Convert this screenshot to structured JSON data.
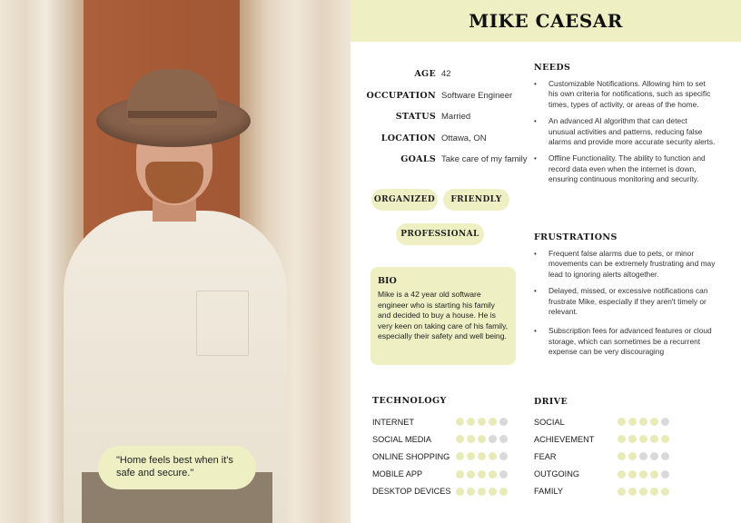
{
  "persona": {
    "name": "MIKE CAESAR",
    "quote": "\"Home feels best when it's safe and secure.\""
  },
  "facts": [
    {
      "key": "AGE",
      "value": "42"
    },
    {
      "key": "OCCUPATION",
      "value": "Software Engineer"
    },
    {
      "key": "STATUS",
      "value": "Married"
    },
    {
      "key": "LOCATION",
      "value": "Ottawa, ON"
    },
    {
      "key": "GOALS",
      "value": "Take care of my family"
    }
  ],
  "traits": [
    "ORGANIZED",
    "FRIENDLY",
    "PROFESSIONAL"
  ],
  "bio": {
    "title": "BIO",
    "text": "Mike is a 42 year old software engineer who is starting his family and decided to buy a house. He is very keen on taking care of his family, especially their safety and well being."
  },
  "needs": {
    "title": "NEEDS",
    "items": [
      "Customizable Notifications. Allowing him to set his own criteria for notifications, such as specific times, types of activity, or areas of the home.",
      "An advanced AI algorithm that can detect unusual activities and patterns, reducing false alarms and provide more accurate security alerts.",
      "Offline Functionality. The ability to function and record data even when the internet is down, ensuring continuous monitoring and security."
    ]
  },
  "frustrations": {
    "title": "FRUSTRATIONS",
    "items": [
      "Frequent false alarms due to pets, or minor movements can be extremely frustrating and may lead to ignoring alerts altogether.",
      "Delayed, missed, or excessive notifications can frustrate Mike, especially if they aren't timely or relevant.",
      "Subscription fees for advanced features or cloud storage, which can sometimes be a recurrent expense can be very discouraging"
    ]
  },
  "technology": {
    "title": "TECHNOLOGY",
    "max": 5,
    "items": [
      {
        "label": "INTERNET",
        "rating": 4
      },
      {
        "label": "SOCIAL MEDIA",
        "rating": 3
      },
      {
        "label": "ONLINE SHOPPING",
        "rating": 4
      },
      {
        "label": "MOBILE APP",
        "rating": 4
      },
      {
        "label": "DESKTOP DEVICES",
        "rating": 5
      }
    ]
  },
  "drive": {
    "title": "DRIVE",
    "max": 5,
    "items": [
      {
        "label": "SOCIAL",
        "rating": 4
      },
      {
        "label": "ACHIEVEMENT",
        "rating": 5
      },
      {
        "label": "FEAR",
        "rating": 2
      },
      {
        "label": "OUTGOING",
        "rating": 4
      },
      {
        "label": "FAMILY",
        "rating": 5
      }
    ]
  },
  "colors": {
    "accent": "#eef0c4",
    "dot_on": "#e8ebb8",
    "dot_off": "#d9d9d9"
  }
}
